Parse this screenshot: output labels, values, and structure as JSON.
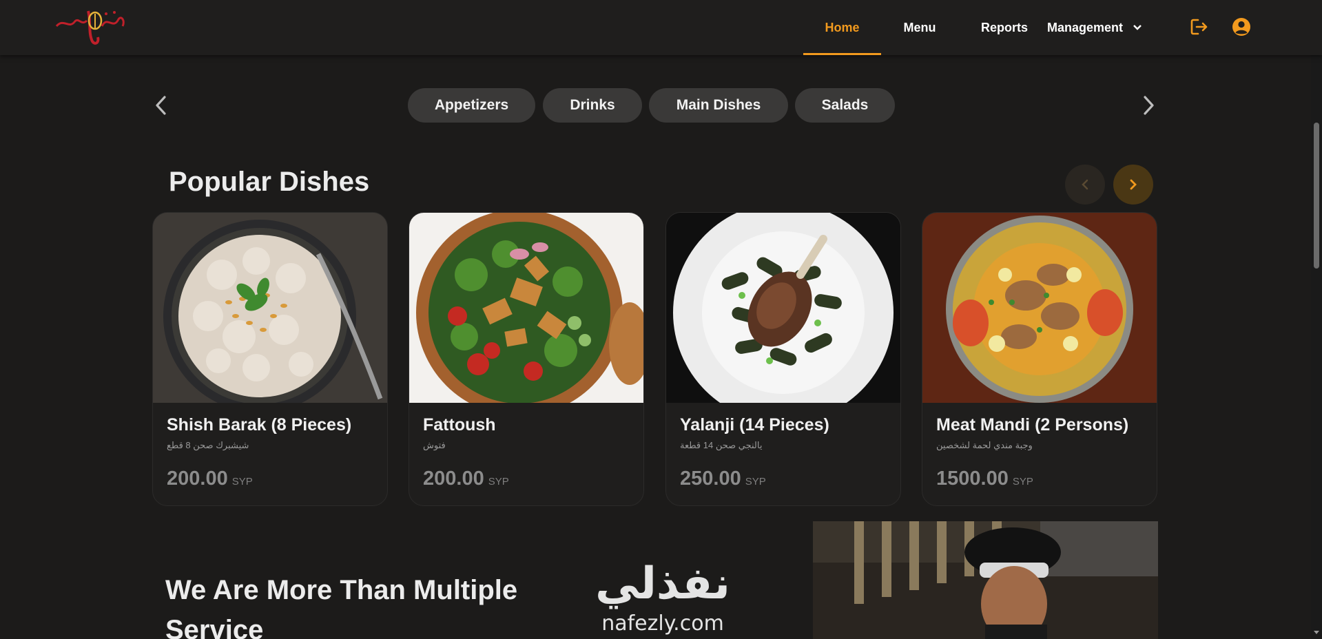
{
  "header": {
    "logo_icon": "restaurant-logo-icon",
    "nav": [
      {
        "label": "Home",
        "active": true
      },
      {
        "label": "Menu",
        "active": false
      },
      {
        "label": "Reports",
        "active": false
      },
      {
        "label": "Management",
        "active": false,
        "has_dropdown": true
      }
    ],
    "logout_icon": "logout-icon",
    "profile_icon": "user-circle-icon",
    "accent": "#f29a1e"
  },
  "categories": [
    "Appetizers",
    "Drinks",
    "Main Dishes",
    "Salads"
  ],
  "popular": {
    "title": "Popular Dishes",
    "dishes": [
      {
        "name": "Shish Barak (8 Pieces)",
        "name_ar": "شيشبرك صحن 8 قطع",
        "price": "200.00",
        "currency": "SYP"
      },
      {
        "name": "Fattoush",
        "name_ar": "فتوش",
        "price": "200.00",
        "currency": "SYP"
      },
      {
        "name": "Yalanji (14 Pieces)",
        "name_ar": "يالنجي صحن 14 قطعة",
        "price": "250.00",
        "currency": "SYP"
      },
      {
        "name": "Meat Mandi (2 Persons)",
        "name_ar": "وجبة مندي لحمة لشخصين",
        "price": "1500.00",
        "currency": "SYP"
      }
    ]
  },
  "about": {
    "title": "We Are More Than Multiple Service"
  },
  "watermark": {
    "ar": "نفذلي",
    "en": "nafezly.com"
  }
}
